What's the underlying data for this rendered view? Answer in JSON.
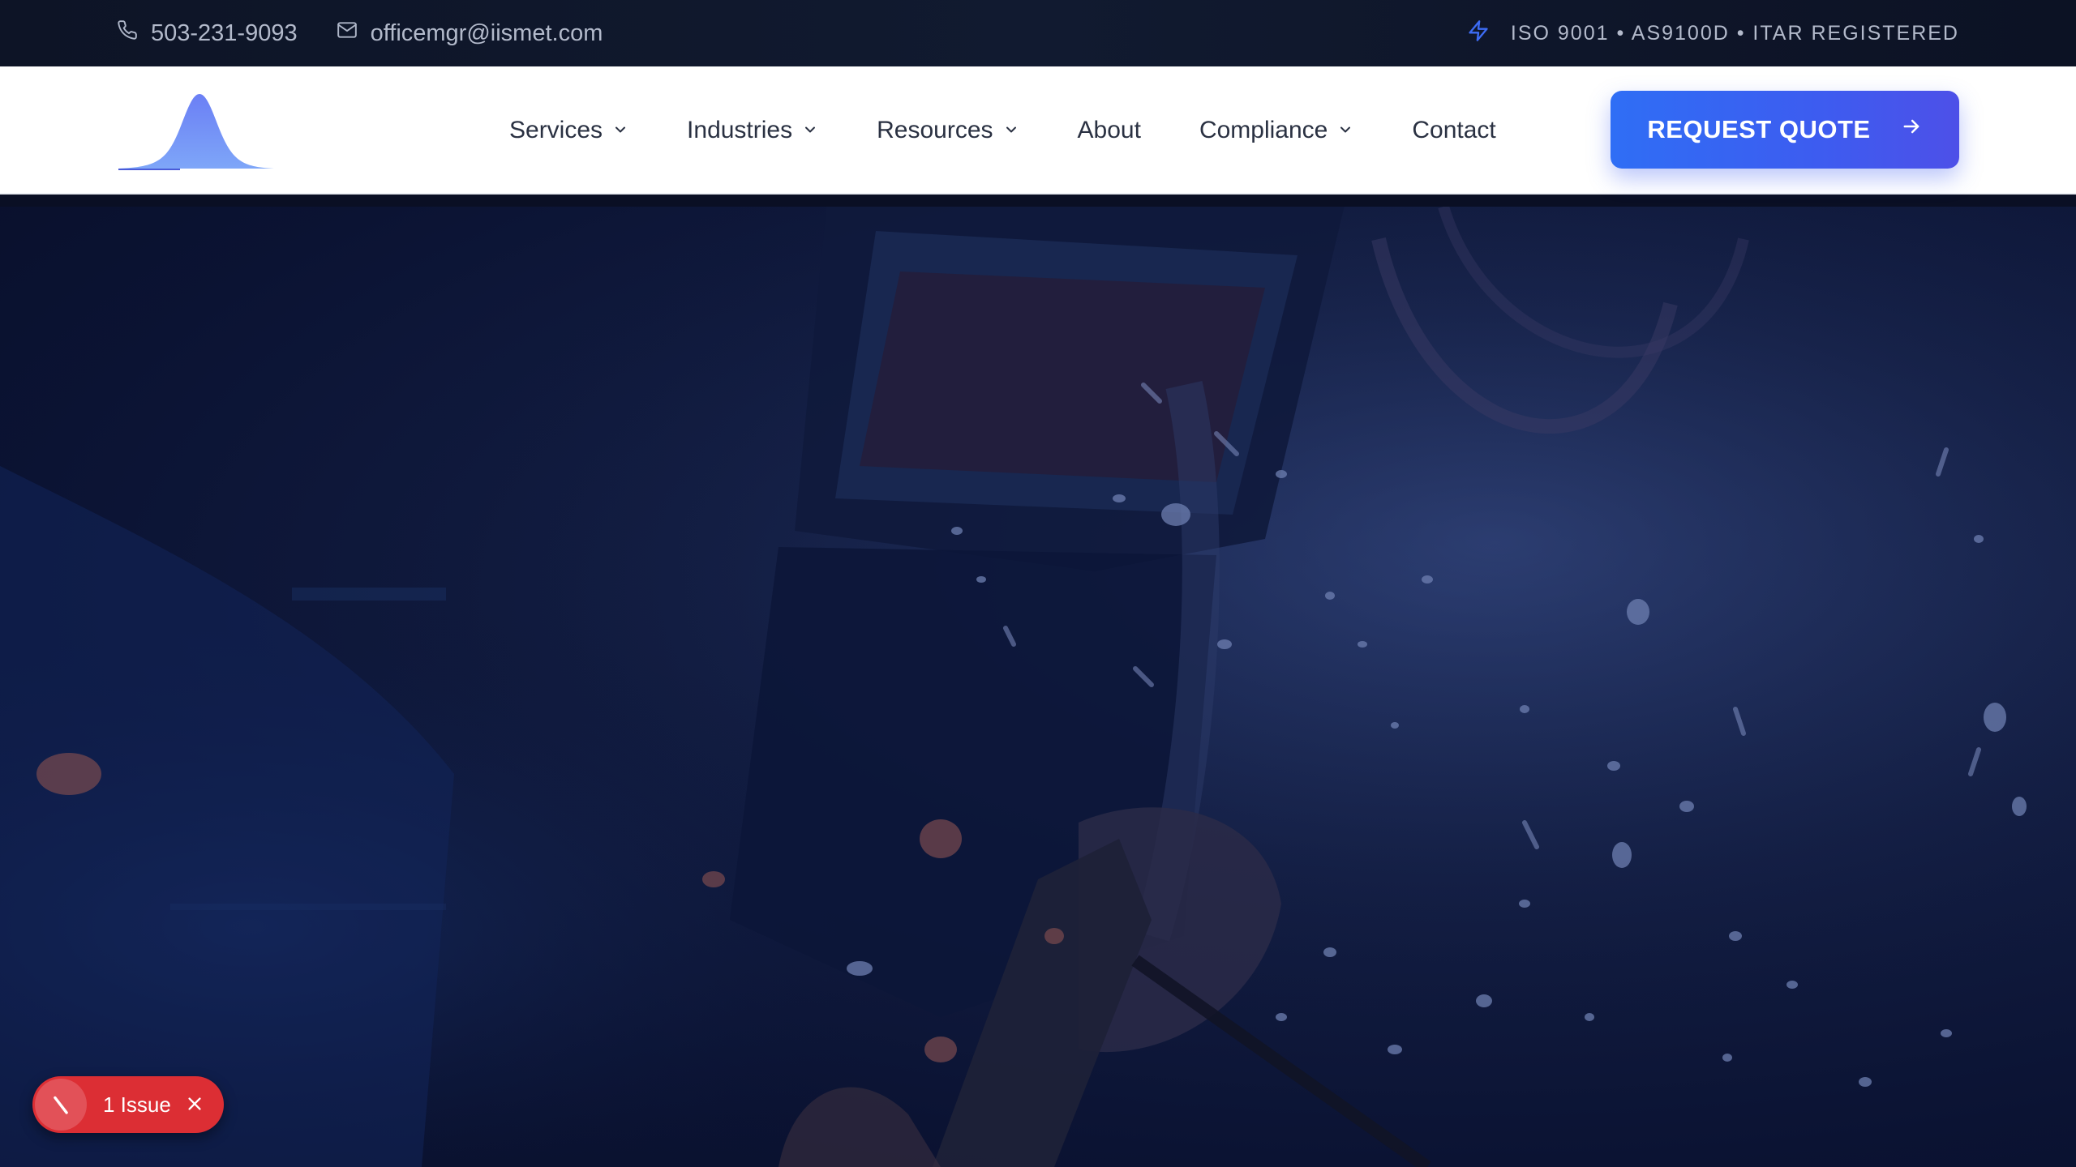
{
  "topbar": {
    "phone": "503-231-9093",
    "email": "officemgr@iismet.com",
    "certifications": "ISO 9001 • AS9100D • ITAR REGISTERED",
    "icons": {
      "phone": "phone-icon",
      "email": "mail-icon",
      "certs": "bolt-icon"
    }
  },
  "nav": {
    "items": [
      {
        "label": "Services",
        "dropdown": true
      },
      {
        "label": "Industries",
        "dropdown": true
      },
      {
        "label": "Resources",
        "dropdown": true
      },
      {
        "label": "About",
        "dropdown": false
      },
      {
        "label": "Compliance",
        "dropdown": true
      },
      {
        "label": "Contact",
        "dropdown": false
      }
    ],
    "cta_label": "REQUEST QUOTE"
  },
  "hero": {
    "image": "welder-at-work-background"
  },
  "dev_overlay": {
    "issue_label": "1 Issue"
  },
  "colors": {
    "topbar_bg": "#0d1426",
    "cta_start": "#2f6ef5",
    "cta_end": "#4d50e8",
    "issue_red": "#dc2e34",
    "logo_top": "#6b7ff5",
    "logo_bottom": "#7ea6f8"
  }
}
